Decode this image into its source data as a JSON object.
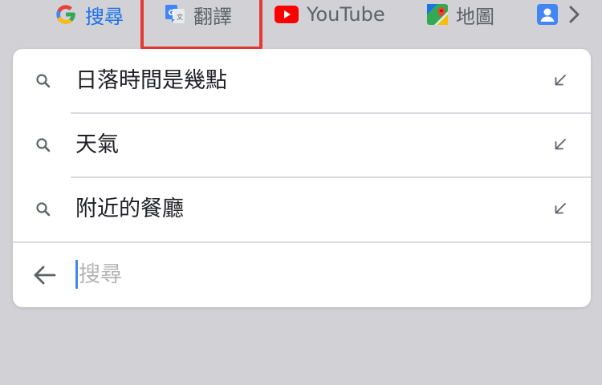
{
  "app_bar": {
    "apps": [
      {
        "label": "搜尋",
        "icon": "google-g-icon"
      },
      {
        "label": "翻譯",
        "icon": "google-translate-icon"
      },
      {
        "label": "YouTube",
        "icon": "youtube-icon"
      },
      {
        "label": "地圖",
        "icon": "google-maps-icon"
      }
    ],
    "more_icon": "chevron-right-icon",
    "contacts_icon": "contacts-icon"
  },
  "suggestions": [
    {
      "text": "日落時間是幾點",
      "icon": "search-icon",
      "action_icon": "fill-query-arrow-icon"
    },
    {
      "text": "天氣",
      "icon": "search-icon",
      "action_icon": "fill-query-arrow-icon"
    },
    {
      "text": "附近的餐廳",
      "icon": "search-icon",
      "action_icon": "fill-query-arrow-icon"
    }
  ],
  "search": {
    "placeholder": "搜尋",
    "value": ""
  },
  "colors": {
    "background": "#d1d1d6",
    "card": "#ffffff",
    "highlight": "#e53935",
    "caret": "#4285f4",
    "google_blue": "#1a73e8",
    "youtube_red": "#ff0000"
  }
}
